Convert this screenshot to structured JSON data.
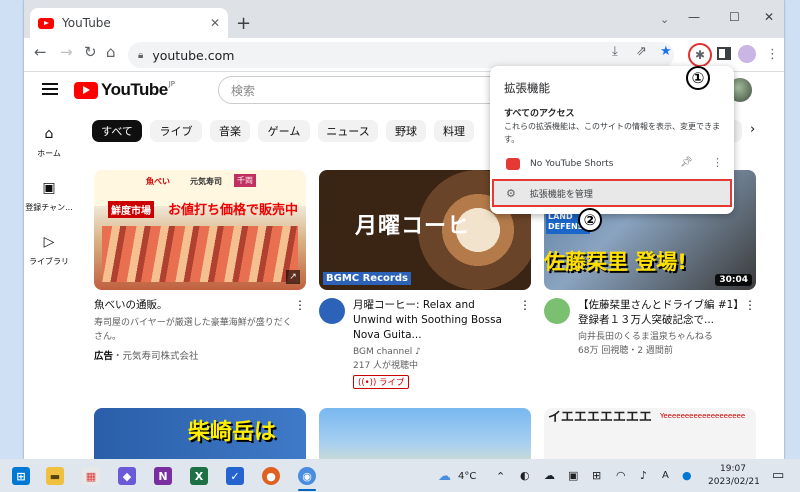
{
  "browser": {
    "tab_title": "YouTube",
    "url": "youtube.com",
    "new_tab": "+",
    "tab_close": "✕"
  },
  "youtube": {
    "logo_text": "YouTube",
    "logo_region": "JP",
    "search_placeholder": "検索",
    "rail": [
      {
        "icon": "⌂",
        "label": "ホーム"
      },
      {
        "icon": "▣",
        "label": "登録チャン..."
      },
      {
        "icon": "▷",
        "label": "ライブラリ"
      }
    ],
    "chips": [
      "すべて",
      "ライブ",
      "音楽",
      "ゲーム",
      "ニュース",
      "野球",
      "料理",
      "ョン"
    ],
    "videos": [
      {
        "thumb_text_1": "魚べい",
        "thumb_text_2": "元気寿司",
        "thumb_text_3": "千両",
        "thumb_tag": "鮮度市場",
        "thumb_headline": "お値打ち価格で販売中",
        "title": "魚べいの通販。",
        "description": "寿司屋のバイヤーが厳選した豪華海鮮が盛りだくさん。",
        "ad_label": "広告",
        "advertiser": "・元気寿司株式会社"
      },
      {
        "thumb_text": "月曜コーヒ",
        "thumb_brand": "BGMC",
        "thumb_brand_tag": "Records",
        "title": "月曜コーヒー: Relax and Unwind with Soothing Bossa Nova Guita...",
        "channel": "BGM channel ♪",
        "viewers": "217 人が視聴中",
        "live_badge": "((•)) ライブ"
      },
      {
        "thumb_text": "佐藤栞里 登場!",
        "thumb_corner": "LAND DEFENS",
        "duration": "30:04",
        "title": "【佐藤栞里さんとドライブ編 #1】登録者１３万人突破記念で...",
        "channel": "向井長田のくるま温泉ちゃんねる",
        "meta": "68万 回視聴・2 週間前"
      }
    ],
    "row2": [
      {
        "thumb_text": "柴崎岳は"
      },
      {
        "thumb_text": ""
      },
      {
        "thumb_text": "イエエエエエエエ",
        "thumb_text_2": "Yeeeeeeeeeeeeeeeeeee"
      }
    ]
  },
  "extensions_popup": {
    "title": "拡張機能",
    "section_title": "すべてのアクセス",
    "description": "これらの拡張機能は、このサイトの情報を表示、変更できます。",
    "extension_name": "No YouTube Shorts",
    "manage_label": "拡張機能を管理"
  },
  "annotations": {
    "one": "①",
    "two": "②"
  },
  "taskbar": {
    "weather": "4°C",
    "time": "19:07",
    "date": "2023/02/21",
    "ime": "A"
  },
  "colors": {
    "youtube_red": "#ff0000",
    "chrome_blue": "#1a73e8",
    "highlight_red": "#e53935"
  }
}
